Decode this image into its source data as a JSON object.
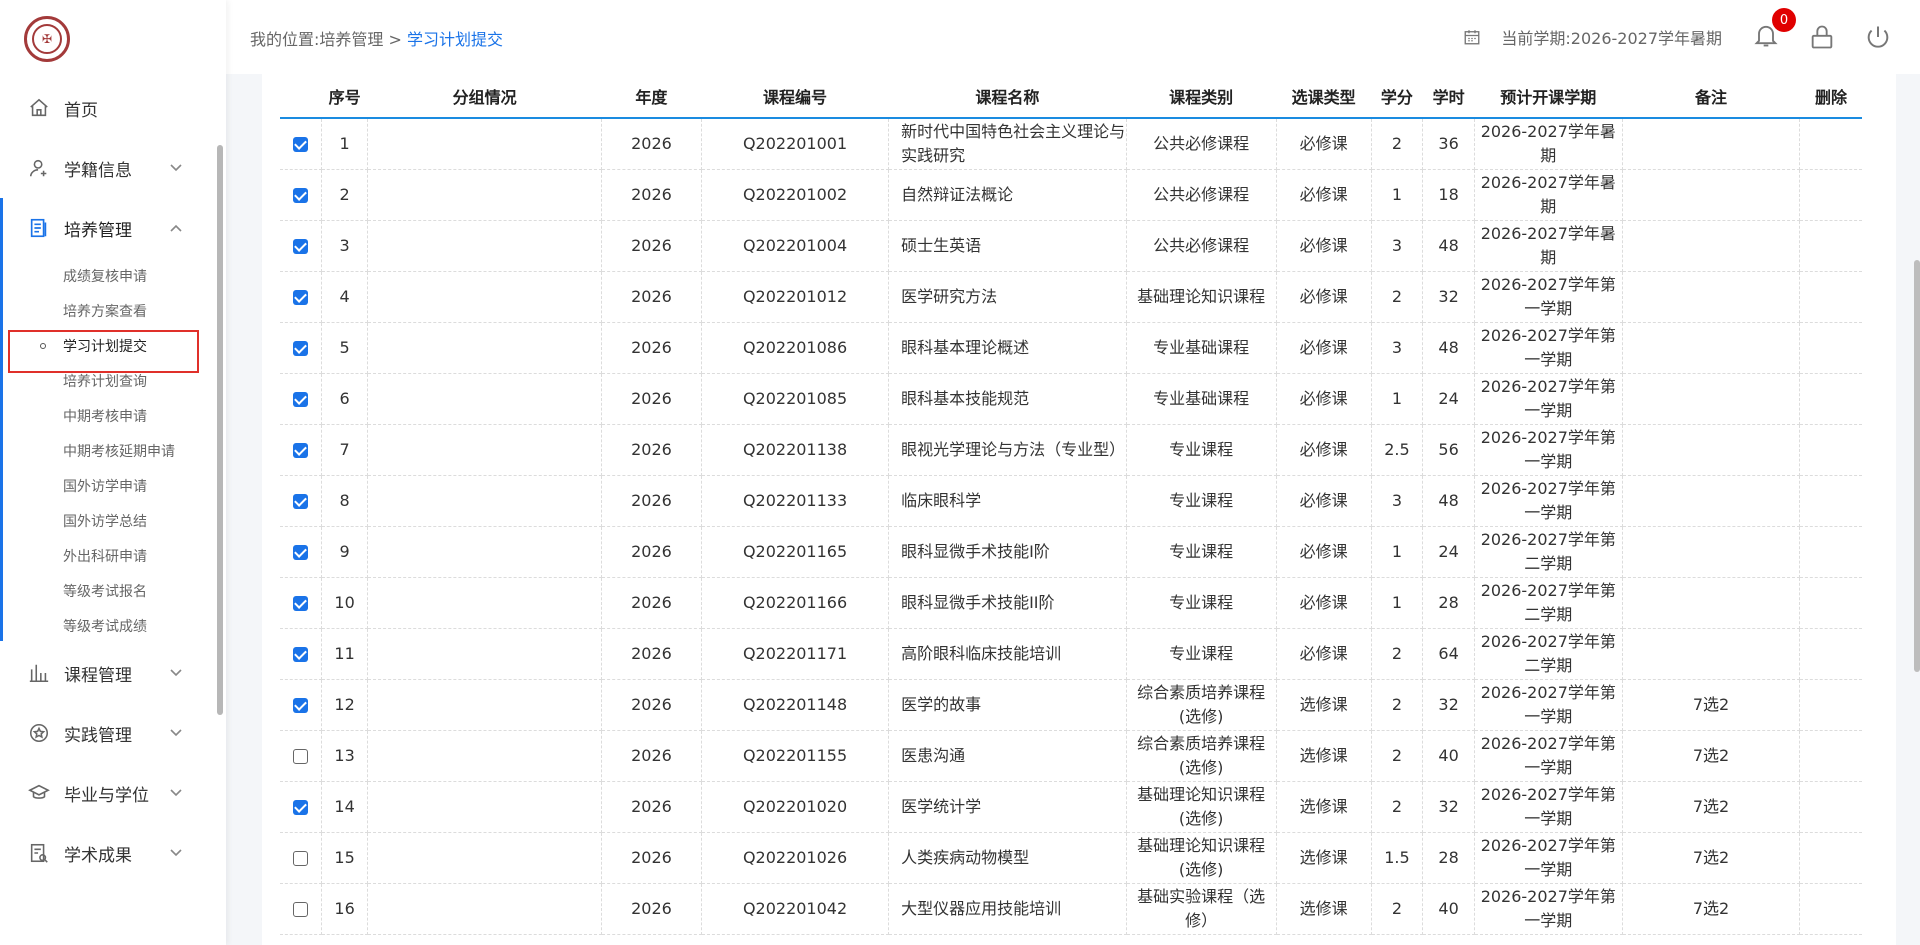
{
  "sidebar": {
    "menu": [
      {
        "label": "首页",
        "icon": "home-icon"
      },
      {
        "label": "学籍信息",
        "icon": "user-icon"
      },
      {
        "label": "培养管理",
        "icon": "document-icon"
      },
      {
        "label": "课程管理",
        "icon": "bar-chart-icon"
      },
      {
        "label": "实践管理",
        "icon": "star-badge-icon"
      },
      {
        "label": "毕业与学位",
        "icon": "graduation-cap-icon"
      },
      {
        "label": "学术成果",
        "icon": "report-icon"
      }
    ],
    "submenu": [
      "成绩复核申请",
      "培养方案查看",
      "学习计划提交",
      "培养计划查询",
      "中期考核申请",
      "中期考核延期申请",
      "国外访学申请",
      "国外访学总结",
      "外出科研申请",
      "等级考试报名",
      "等级考试成绩"
    ]
  },
  "header": {
    "breadcrumb_prefix": "我的位置:培养管理 > ",
    "breadcrumb_current": "学习计划提交",
    "term": "当前学期:2026-2027学年暑期",
    "notification_count": "0"
  },
  "table": {
    "headers": [
      "序号",
      "分组情况",
      "年度",
      "课程编号",
      "课程名称",
      "课程类别",
      "选课类型",
      "学分",
      "学时",
      "预计开课学期",
      "备注",
      "删除"
    ],
    "rows": [
      {
        "checked": true,
        "no": "1",
        "group": "",
        "year": "2026",
        "code": "Q202201001",
        "name": "新时代中国特色社会主义理论与实践研究",
        "category": "公共必修课程",
        "type": "必修课",
        "credit": "2",
        "hours": "36",
        "term": "2026-2027学年暑期",
        "note": ""
      },
      {
        "checked": true,
        "no": "2",
        "group": "",
        "year": "2026",
        "code": "Q202201002",
        "name": "自然辩证法概论",
        "category": "公共必修课程",
        "type": "必修课",
        "credit": "1",
        "hours": "18",
        "term": "2026-2027学年暑期",
        "note": ""
      },
      {
        "checked": true,
        "no": "3",
        "group": "",
        "year": "2026",
        "code": "Q202201004",
        "name": "硕士生英语",
        "category": "公共必修课程",
        "type": "必修课",
        "credit": "3",
        "hours": "48",
        "term": "2026-2027学年暑期",
        "note": ""
      },
      {
        "checked": true,
        "no": "4",
        "group": "",
        "year": "2026",
        "code": "Q202201012",
        "name": "医学研究方法",
        "category": "基础理论知识课程",
        "type": "必修课",
        "credit": "2",
        "hours": "32",
        "term": "2026-2027学年第一学期",
        "note": ""
      },
      {
        "checked": true,
        "no": "5",
        "group": "",
        "year": "2026",
        "code": "Q202201086",
        "name": "眼科基本理论概述",
        "category": "专业基础课程",
        "type": "必修课",
        "credit": "3",
        "hours": "48",
        "term": "2026-2027学年第一学期",
        "note": ""
      },
      {
        "checked": true,
        "no": "6",
        "group": "",
        "year": "2026",
        "code": "Q202201085",
        "name": "眼科基本技能规范",
        "category": "专业基础课程",
        "type": "必修课",
        "credit": "1",
        "hours": "24",
        "term": "2026-2027学年第一学期",
        "note": ""
      },
      {
        "checked": true,
        "no": "7",
        "group": "",
        "year": "2026",
        "code": "Q202201138",
        "name": "眼视光学理论与方法（专业型）",
        "category": "专业课程",
        "type": "必修课",
        "credit": "2.5",
        "hours": "56",
        "term": "2026-2027学年第一学期",
        "note": ""
      },
      {
        "checked": true,
        "no": "8",
        "group": "",
        "year": "2026",
        "code": "Q202201133",
        "name": "临床眼科学",
        "category": "专业课程",
        "type": "必修课",
        "credit": "3",
        "hours": "48",
        "term": "2026-2027学年第一学期",
        "note": ""
      },
      {
        "checked": true,
        "no": "9",
        "group": "",
        "year": "2026",
        "code": "Q202201165",
        "name": "眼科显微手术技能I阶",
        "category": "专业课程",
        "type": "必修课",
        "credit": "1",
        "hours": "24",
        "term": "2026-2027学年第二学期",
        "note": ""
      },
      {
        "checked": true,
        "no": "10",
        "group": "",
        "year": "2026",
        "code": "Q202201166",
        "name": "眼科显微手术技能II阶",
        "category": "专业课程",
        "type": "必修课",
        "credit": "1",
        "hours": "28",
        "term": "2026-2027学年第二学期",
        "note": ""
      },
      {
        "checked": true,
        "no": "11",
        "group": "",
        "year": "2026",
        "code": "Q202201171",
        "name": "高阶眼科临床技能培训",
        "category": "专业课程",
        "type": "必修课",
        "credit": "2",
        "hours": "64",
        "term": "2026-2027学年第二学期",
        "note": ""
      },
      {
        "checked": true,
        "no": "12",
        "group": "",
        "year": "2026",
        "code": "Q202201148",
        "name": "医学的故事",
        "category": "综合素质培养课程(选修)",
        "type": "选修课",
        "credit": "2",
        "hours": "32",
        "term": "2026-2027学年第一学期",
        "note": "7选2"
      },
      {
        "checked": false,
        "no": "13",
        "group": "",
        "year": "2026",
        "code": "Q202201155",
        "name": "医患沟通",
        "category": "综合素质培养课程(选修)",
        "type": "选修课",
        "credit": "2",
        "hours": "40",
        "term": "2026-2027学年第一学期",
        "note": "7选2"
      },
      {
        "checked": true,
        "no": "14",
        "group": "",
        "year": "2026",
        "code": "Q202201020",
        "name": "医学统计学",
        "category": "基础理论知识课程(选修)",
        "type": "选修课",
        "credit": "2",
        "hours": "32",
        "term": "2026-2027学年第一学期",
        "note": "7选2"
      },
      {
        "checked": false,
        "no": "15",
        "group": "",
        "year": "2026",
        "code": "Q202201026",
        "name": "人类疾病动物模型",
        "category": "基础理论知识课程(选修)",
        "type": "选修课",
        "credit": "1.5",
        "hours": "28",
        "term": "2026-2027学年第一学期",
        "note": "7选2"
      },
      {
        "checked": false,
        "no": "16",
        "group": "",
        "year": "2026",
        "code": "Q202201042",
        "name": "大型仪器应用技能培训",
        "category": "基础实验课程（选修）",
        "type": "选修课",
        "credit": "2",
        "hours": "40",
        "term": "2026-2027学年第一学期",
        "note": "7选2"
      }
    ]
  },
  "colors": {
    "accent": "#1a73e8",
    "badge": "#e00000",
    "highlight": "#e0302a"
  }
}
